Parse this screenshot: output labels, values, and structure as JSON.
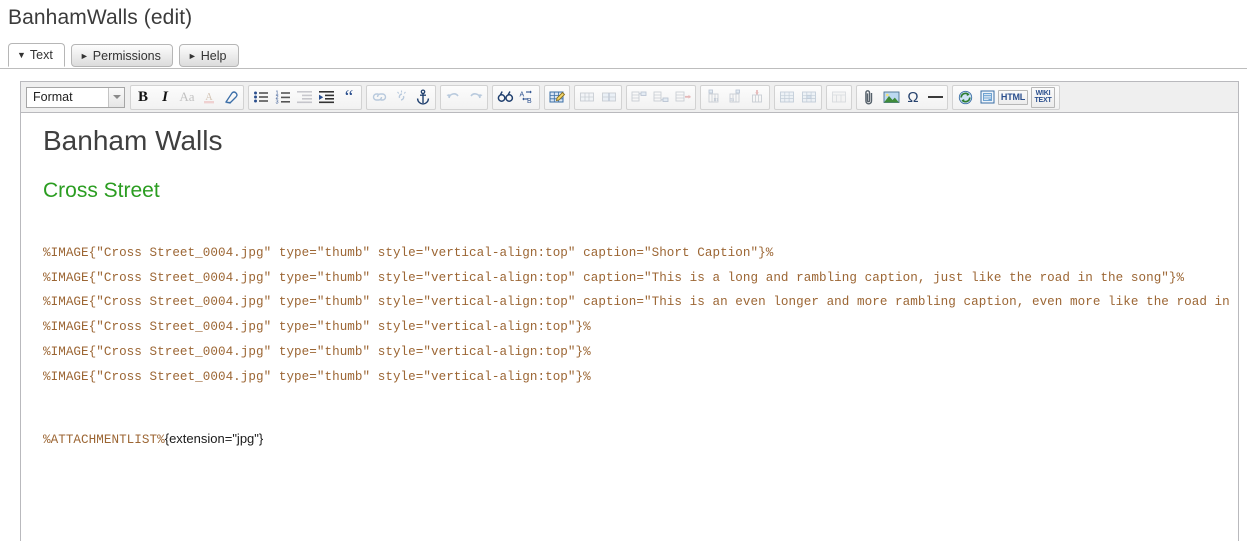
{
  "page": {
    "title": "BanhamWalls (edit)"
  },
  "tabs": [
    {
      "label": "Text",
      "marker": "▼",
      "active": true,
      "name": "tab-text"
    },
    {
      "label": "Permissions",
      "marker": "►",
      "active": false,
      "name": "tab-permissions"
    },
    {
      "label": "Help",
      "marker": "►",
      "active": false,
      "name": "tab-help"
    }
  ],
  "toolbar": {
    "format_select": {
      "value": "Format",
      "icon": "chevron-down-icon"
    },
    "groups": [
      {
        "name": "text-style-group",
        "buttons": [
          {
            "name": "bold-icon",
            "glyph": "B",
            "disabled": false
          },
          {
            "name": "italic-icon",
            "glyph": "I",
            "disabled": false
          },
          {
            "name": "font-size-icon",
            "glyph": "Aa",
            "disabled": true
          },
          {
            "name": "text-color-icon",
            "glyph": "A",
            "disabled": true
          },
          {
            "name": "remove-format-icon",
            "glyph": "eraser",
            "disabled": false
          }
        ]
      },
      {
        "name": "list-indent-group",
        "buttons": [
          {
            "name": "bulleted-list-icon",
            "glyph": "ul",
            "disabled": false
          },
          {
            "name": "numbered-list-icon",
            "glyph": "ol",
            "disabled": false
          },
          {
            "name": "outdent-icon",
            "glyph": "outdent",
            "disabled": true
          },
          {
            "name": "indent-icon",
            "glyph": "indent",
            "disabled": false
          },
          {
            "name": "blockquote-icon",
            "glyph": "“",
            "disabled": false
          }
        ]
      },
      {
        "name": "link-group",
        "buttons": [
          {
            "name": "link-icon",
            "glyph": "link",
            "disabled": true
          },
          {
            "name": "unlink-icon",
            "glyph": "unlink",
            "disabled": true
          },
          {
            "name": "anchor-icon",
            "glyph": "anchor",
            "disabled": false
          }
        ]
      },
      {
        "name": "history-group",
        "buttons": [
          {
            "name": "undo-icon",
            "glyph": "undo",
            "disabled": true
          },
          {
            "name": "redo-icon",
            "glyph": "redo",
            "disabled": true
          }
        ]
      },
      {
        "name": "search-group",
        "buttons": [
          {
            "name": "find-icon",
            "glyph": "find",
            "disabled": false
          },
          {
            "name": "replace-icon",
            "glyph": "replace",
            "disabled": false
          }
        ]
      },
      {
        "name": "table-create-group",
        "buttons": [
          {
            "name": "edit-table-icon",
            "glyph": "edittable",
            "disabled": false
          }
        ]
      },
      {
        "name": "table-cell-group",
        "buttons": [
          {
            "name": "merge-cells-icon",
            "glyph": "mergecells",
            "disabled": true
          },
          {
            "name": "split-cell-icon",
            "glyph": "splitcell",
            "disabled": true
          }
        ]
      },
      {
        "name": "table-row-group",
        "buttons": [
          {
            "name": "insert-row-before-icon",
            "glyph": "rowbefore",
            "disabled": true
          },
          {
            "name": "insert-row-after-icon",
            "glyph": "rowafter",
            "disabled": true
          },
          {
            "name": "delete-row-icon",
            "glyph": "delrow",
            "disabled": true
          }
        ]
      },
      {
        "name": "table-column-group",
        "buttons": [
          {
            "name": "insert-column-before-icon",
            "glyph": "colbefore",
            "disabled": true
          },
          {
            "name": "insert-column-after-icon",
            "glyph": "colafter",
            "disabled": true
          },
          {
            "name": "delete-column-icon",
            "glyph": "delcol",
            "disabled": true
          }
        ]
      },
      {
        "name": "table-props-group",
        "buttons": [
          {
            "name": "table-properties-icon",
            "glyph": "tableprops",
            "disabled": true
          },
          {
            "name": "table-cell-properties-icon",
            "glyph": "cellprops",
            "disabled": true
          }
        ]
      },
      {
        "name": "table-delete-group",
        "buttons": [
          {
            "name": "delete-table-icon",
            "glyph": "deltable",
            "disabled": true
          }
        ]
      },
      {
        "name": "insert-group",
        "buttons": [
          {
            "name": "attachment-icon",
            "glyph": "paperclip",
            "disabled": false
          },
          {
            "name": "insert-image-icon",
            "glyph": "image",
            "disabled": false
          },
          {
            "name": "special-character-icon",
            "glyph": "Ω",
            "disabled": false
          },
          {
            "name": "horizontal-rule-icon",
            "glyph": "hrule",
            "disabled": false
          }
        ]
      },
      {
        "name": "view-group",
        "buttons": [
          {
            "name": "refresh-icon",
            "glyph": "refresh",
            "disabled": false
          },
          {
            "name": "page-preview-icon",
            "glyph": "page",
            "disabled": false
          },
          {
            "name": "html-source-button",
            "glyph": "HTML",
            "disabled": false
          },
          {
            "name": "wiki-text-button",
            "glyph": "WIKI TEXT",
            "disabled": false
          }
        ]
      }
    ]
  },
  "document": {
    "heading": "Banham Walls",
    "subheading": "Cross Street",
    "macro_lines": [
      "%IMAGE{\"Cross Street_0004.jpg\" type=\"thumb\" style=\"vertical-align:top\" caption=\"Short Caption\"}%",
      "%IMAGE{\"Cross Street_0004.jpg\" type=\"thumb\" style=\"vertical-align:top\" caption=\"This is a long and rambling caption, just like the road in the song\"}%",
      "%IMAGE{\"Cross Street_0004.jpg\" type=\"thumb\" style=\"vertical-align:top\" caption=\"This is an even longer and more rambling caption, even more like the road in the song\"}%",
      "%IMAGE{\"Cross Street_0004.jpg\" type=\"thumb\" style=\"vertical-align:top\"}%",
      "%IMAGE{\"Cross Street_0004.jpg\" type=\"thumb\" style=\"vertical-align:top\"}%",
      "%IMAGE{\"Cross Street_0004.jpg\" type=\"thumb\" style=\"vertical-align:top\"}%"
    ],
    "attachment_macro": "%ATTACHMENTLIST%",
    "attachment_args": "{extension=\"jpg\"}"
  },
  "colors": {
    "macro_text": "#9c6634",
    "subheading": "#2b9d21",
    "heading": "#3f3f3f",
    "toolbar_bg": "#efefef",
    "frame_border": "#b9b9bd"
  }
}
